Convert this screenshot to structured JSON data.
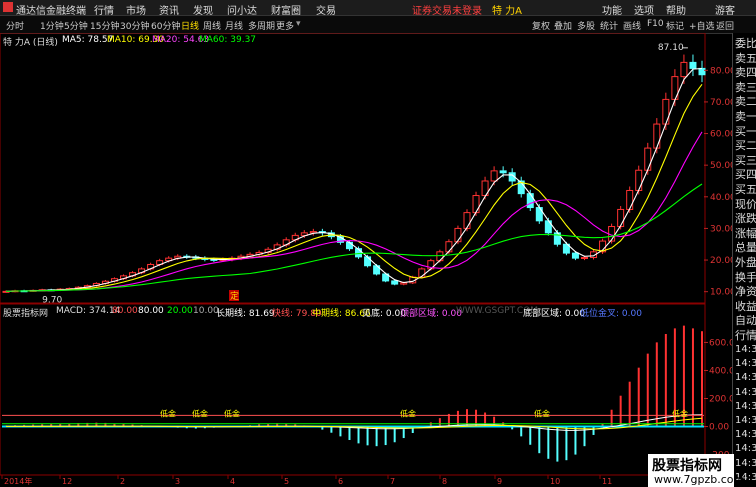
{
  "titlebar": {
    "app_name": "通达信金融终端",
    "menus": [
      "行情",
      "市场",
      "资讯",
      "发现",
      "问小达",
      "财富圈",
      "交易"
    ],
    "login_status": "证券交易未登录",
    "stock": "特 力A",
    "right": [
      "功能",
      "选项",
      "帮助",
      "游客"
    ]
  },
  "toolbar": {
    "periods": [
      "分时",
      "1分钟",
      "5分钟",
      "15分钟",
      "30分钟",
      "60分钟",
      "日线",
      "周线",
      "月线",
      "多周期",
      "更多"
    ],
    "active_period": "日线",
    "tools": [
      "复权",
      "叠加",
      "多股",
      "统计",
      "画线",
      "F10",
      "标记",
      "+自选",
      "返回"
    ]
  },
  "infobar": {
    "stock_label": "特 力A (日线)",
    "ma5": "MA5: 78.57",
    "ma10": "MA10: 69.30",
    "ma20": "MA20: 54.63",
    "ma60": "MA60: 39.37"
  },
  "indicator_bar": {
    "source": "股票指标网",
    "macd": "MACD: 374.14",
    "v1": "80.00",
    "v2": "80.00",
    "v3": "20.00",
    "v4": "10.00",
    "long_line": "长期线: 81.69",
    "fast_line": "快线: 79.80",
    "mid_line": "中期线: 86.66",
    "see_bottom": "见底: 0.00",
    "top_zone": "顶部区域: 0.00",
    "site": "WWW.GSGPT.COM",
    "bottom_zone": "底部区域: 0.00",
    "low_gold": "低位金叉: 0.00"
  },
  "chart_labels": {
    "high_price": "87.10",
    "low_price": "9.70",
    "ding": "定",
    "lowgold_marks": [
      "低金",
      "低金",
      "低金",
      "低金",
      "低金",
      "低金"
    ]
  },
  "side_panel": {
    "items": [
      "委比",
      "卖五",
      "卖四",
      "卖三",
      "卖二",
      "卖一",
      "买一",
      "买二",
      "买三",
      "买四",
      "买五",
      "现价",
      "涨跌",
      "涨幅",
      "总量",
      "外盘",
      "换手",
      "净资",
      "收益",
      "自动",
      "行情"
    ],
    "times": [
      "14:35",
      "14:35",
      "14:35",
      "14:35",
      "14:35",
      "14:35",
      "14:35",
      "14:35",
      "14:35",
      "14:35"
    ]
  },
  "axis": {
    "price_ticks": [
      "80.00",
      "70.00",
      "60.00",
      "50.00",
      "40.00",
      "30.00",
      "20.00",
      "10.00"
    ],
    "macd_ticks": [
      "600.00",
      "400.00",
      "200.00",
      "0.00",
      "-200.00"
    ],
    "date_labels": [
      "2014年",
      "12",
      "2",
      "3",
      "4",
      "5",
      "6",
      "7",
      "8",
      "9",
      "10",
      "11"
    ]
  },
  "watermark": {
    "title": "股票指标网",
    "url": "www.7gpzb.com"
  },
  "colors": {
    "up": "#ff3232",
    "down": "#54ffff",
    "ma5": "#ffffff",
    "ma10": "#ffff00",
    "ma20": "#ff00ff",
    "ma60": "#00ff00",
    "grid": "#8b0000"
  },
  "chart_data": {
    "type": "line",
    "price_axis": {
      "ylim": [
        8,
        88
      ],
      "ticks": [
        80,
        70,
        60,
        50,
        40,
        30,
        20,
        10
      ]
    },
    "close_series": [
      10.1,
      10.3,
      10.2,
      10.4,
      10.6,
      10.5,
      10.8,
      11.0,
      11.4,
      11.9,
      12.6,
      13.3,
      14.1,
      15.0,
      16.0,
      17.2,
      18.6,
      19.8,
      20.6,
      21.2,
      21.0,
      20.6,
      20.2,
      20.0,
      20.2,
      20.6,
      21.2,
      21.8,
      22.4,
      23.4,
      24.8,
      26.4,
      27.8,
      28.6,
      29.0,
      28.6,
      27.4,
      25.6,
      23.6,
      21.0,
      18.2,
      15.6,
      13.4,
      12.4,
      12.8,
      14.6,
      17.2,
      19.8,
      22.6,
      25.8,
      30.0,
      35.0,
      40.4,
      45.0,
      48.2,
      47.6,
      45.0,
      41.0,
      36.6,
      32.4,
      28.6,
      25.0,
      22.2,
      20.6,
      20.8,
      22.6,
      26.0,
      30.6,
      36.0,
      42.0,
      48.4,
      55.4,
      63.0,
      70.8,
      78.0,
      82.5,
      80.6,
      78.6
    ],
    "macd_axis": {
      "ylim": [
        -260,
        760
      ],
      "ticks": [
        600,
        400,
        200,
        0,
        -200
      ]
    },
    "macd_series": [
      8,
      10,
      12,
      14,
      16,
      18,
      20,
      22,
      25,
      26,
      28,
      26,
      22,
      18,
      14,
      10,
      6,
      2,
      -4,
      -8,
      -12,
      -14,
      -12,
      -8,
      -4,
      0,
      4,
      10,
      16,
      20,
      24,
      20,
      16,
      8,
      -6,
      -22,
      -44,
      -70,
      -96,
      -120,
      -134,
      -140,
      -132,
      -112,
      -82,
      -46,
      -10,
      30,
      60,
      90,
      112,
      124,
      120,
      100,
      70,
      30,
      -20,
      -70,
      -130,
      -190,
      -230,
      -250,
      -240,
      -200,
      -140,
      -60,
      20,
      120,
      220,
      320,
      420,
      520,
      600,
      660,
      700,
      720,
      700,
      680
    ],
    "series": [
      {
        "name": "MA5"
      },
      {
        "name": "MA10"
      },
      {
        "name": "MA20"
      },
      {
        "name": "MA60"
      }
    ]
  }
}
